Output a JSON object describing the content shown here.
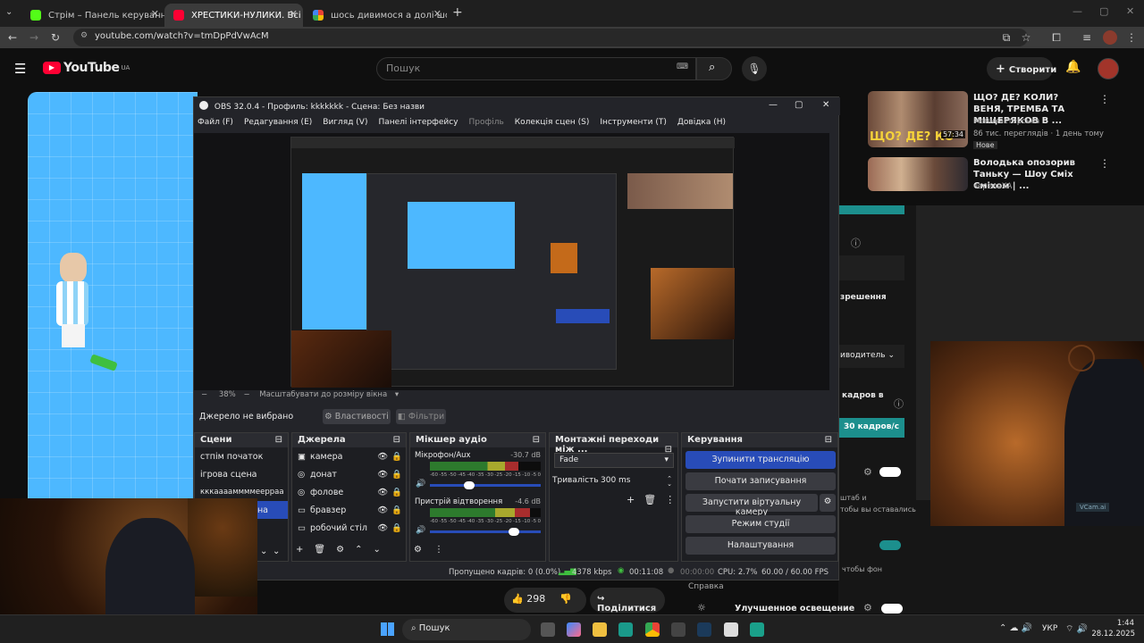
{
  "browser": {
    "tabs": [
      {
        "title": "Стрім – Панель керування Ki"
      },
      {
        "title": "ХРЕСТИКИ-НУЛИКИ. Всі раун"
      },
      {
        "title": "шось дивимося а долі шось і"
      }
    ],
    "url": "youtube.com/watch?v=tmDpPdVwAcM"
  },
  "youtube": {
    "logo": "YouTube",
    "region": "UA",
    "search_placeholder": "Пошук",
    "create_label": "Створити",
    "recommendations": [
      {
        "title": "ЩО? ДЕ? КОЛИ? ВЕНЯ, ТРЕМБА ТА МІЩЕРЯКОВ В ...",
        "channel": "Мейнкастерська",
        "meta": "86 тис. переглядів · 1 день тому",
        "badge": "Нове",
        "duration": "57:34",
        "thumb_text": "ЩО? ДЕ? КО"
      },
      {
        "title": "Володька опозорив Таньку — Шоу Сміх Сміхом | ...",
        "channel": "черепаХА"
      }
    ],
    "like_count": "298",
    "share_label": "Поділитися",
    "settings_partial": {
      "resolution": "зрешення",
      "producer": "иводитель",
      "frames": "кадров в",
      "fps_btn": "30 кадров/с",
      "scale": "штаб и",
      "scale2": "тобы вы оставались",
      "text_fon": "чтобы фон",
      "help": "Справка",
      "lighting": "Улучшенное освещение"
    }
  },
  "obs": {
    "title": "OBS 32.0.4 - Профиль: kkkkkkk - Сцена: Без назви",
    "menu": [
      "Файл (F)",
      "Редагування (E)",
      "Вигляд (V)",
      "Панелі інтерфейсу",
      "Профіль",
      "Колекція сцен (S)",
      "Інструменти (T)",
      "Довідка (H)"
    ],
    "zoom": "38%",
    "zoom_label": "Масштабувати до розміру вікна",
    "no_source": "Джерело не вибрано",
    "properties": "Властивості",
    "filters": "Фільтри",
    "scenes_title": "Сцени",
    "scenes": [
      "стпім початок",
      "ігрова сцена",
      "кккааааммммеерраа",
      "на"
    ],
    "sources_title": "Джерела",
    "sources": [
      "камера",
      "донат",
      "фолове",
      "бравзер",
      "робочий стіл"
    ],
    "mixer_title": "Мікшер аудіо",
    "mixer": [
      {
        "name": "Мікрофон/Aux",
        "db": "-30.7 dB",
        "level": 0.8
      },
      {
        "name": "Пристрій відтворення",
        "db": "-4.6 dB",
        "level": 0.9
      }
    ],
    "meter_ticks": [
      "-60",
      "-55",
      "-50",
      "-45",
      "-40",
      "-35",
      "-30",
      "-25",
      "-20",
      "-15",
      "-10",
      "-5",
      "0"
    ],
    "transitions_title": "Монтажні переходи між ...",
    "transition": "Fade",
    "duration_label": "Тривалість",
    "duration": "300 ms",
    "controls_title": "Керування",
    "controls": [
      "Зупинити трансляцію",
      "Почати записування",
      "Запустити віртуальну камеру",
      "Режим студії",
      "Налаштування"
    ],
    "status": {
      "dropped": "Пропущено кадрів: 0 (0.0%)",
      "bitrate": "4378 kbps",
      "live_time": "00:11:08",
      "rec_time": "00:00:00",
      "cpu": "CPU: 2.7%",
      "fps": "60.00 / 60.00 FPS"
    }
  },
  "webcam_tag": "VCam.ai",
  "taskbar": {
    "search": "Пошук",
    "lang": "УКР",
    "time": "1:44",
    "date": "28.12.2025"
  }
}
